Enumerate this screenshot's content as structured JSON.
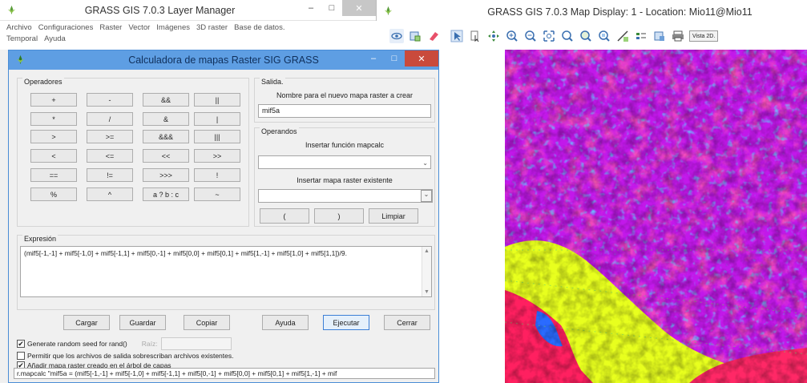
{
  "layer_manager": {
    "title": "GRASS GIS 7.0.3 Layer Manager",
    "menu": [
      "Archivo",
      "Configuraciones",
      "Raster",
      "Vector",
      "Imágenes",
      "3D raster",
      "Base de datos.",
      "Temporal",
      "Ayuda"
    ]
  },
  "calculator": {
    "title": "Calculadora de mapas Raster SIG GRASS",
    "operators_label": "Operadores",
    "operators": [
      [
        "+",
        "-",
        "&&",
        "||"
      ],
      [
        "*",
        "/",
        "&",
        "|"
      ],
      [
        ">",
        ">=",
        "&&&",
        "|||"
      ],
      [
        "<",
        "<=",
        "<<",
        ">>"
      ],
      [
        "==",
        "!=",
        ">>>",
        "!"
      ],
      [
        "%",
        "^",
        "a ? b : c",
        "~"
      ]
    ],
    "output_label": "Salida.",
    "output_caption": "Nombre para el nuevo mapa raster a crear",
    "output_value": "mif5a",
    "operands_label": "Operandos",
    "insert_function_caption": "Insertar función mapcalc",
    "insert_function_value": "",
    "insert_map_caption": "Insertar mapa raster existente",
    "insert_map_value": "",
    "paren_open": "(",
    "paren_close": ")",
    "clear_label": "Limpiar",
    "expression_label": "Expresión",
    "expression": "(mif5[-1,-1] + mif5[-1,0] + mif5[-1,1] + mif5[0,-1] + mif5[0,0] + mif5[0,1] + mif5[1,-1] + mif5[1,0] + mif5[1,1])/9.",
    "buttons": {
      "load": "Cargar",
      "save": "Guardar",
      "copy": "Copiar",
      "help": "Ayuda",
      "run": "Ejecutar",
      "close": "Cerrar"
    },
    "seed_check_label": "Generate random seed for rand()",
    "seed_checked": true,
    "seed_label": "Raíz:",
    "overwrite_label": "Permitir que los archivos de salida sobrescriban archivos existentes.",
    "overwrite_checked": false,
    "add_layer_label": "Añadir mapa raster creado en el árbol de capas",
    "add_layer_checked": true,
    "command": "r.mapcalc \"mif5a = (mif5[-1,-1] + mif5[-1,0] + mif5[-1,1] + mif5[0,-1] + mif5[0,0] + mif5[0,1] + mif5[1,-1] + mif"
  },
  "map_display": {
    "title": "GRASS GIS 7.0.3 Map Display: 1  - Location: Mio11@Mio11",
    "view_label": "Vista 2D.",
    "tools": [
      "display-icon",
      "render-icon",
      "erase-icon",
      "pointer-icon",
      "query-icon",
      "pan-icon",
      "zoom-in-icon",
      "zoom-out-icon",
      "zoom-extent-icon",
      "zoom-back-icon",
      "zoom-map-icon",
      "zoom-options-icon",
      "measure-icon",
      "legend-icon",
      "save-icon",
      "print-icon"
    ]
  },
  "colors": {
    "accent": "#5e9ee3",
    "close_red": "#c94a3c"
  }
}
